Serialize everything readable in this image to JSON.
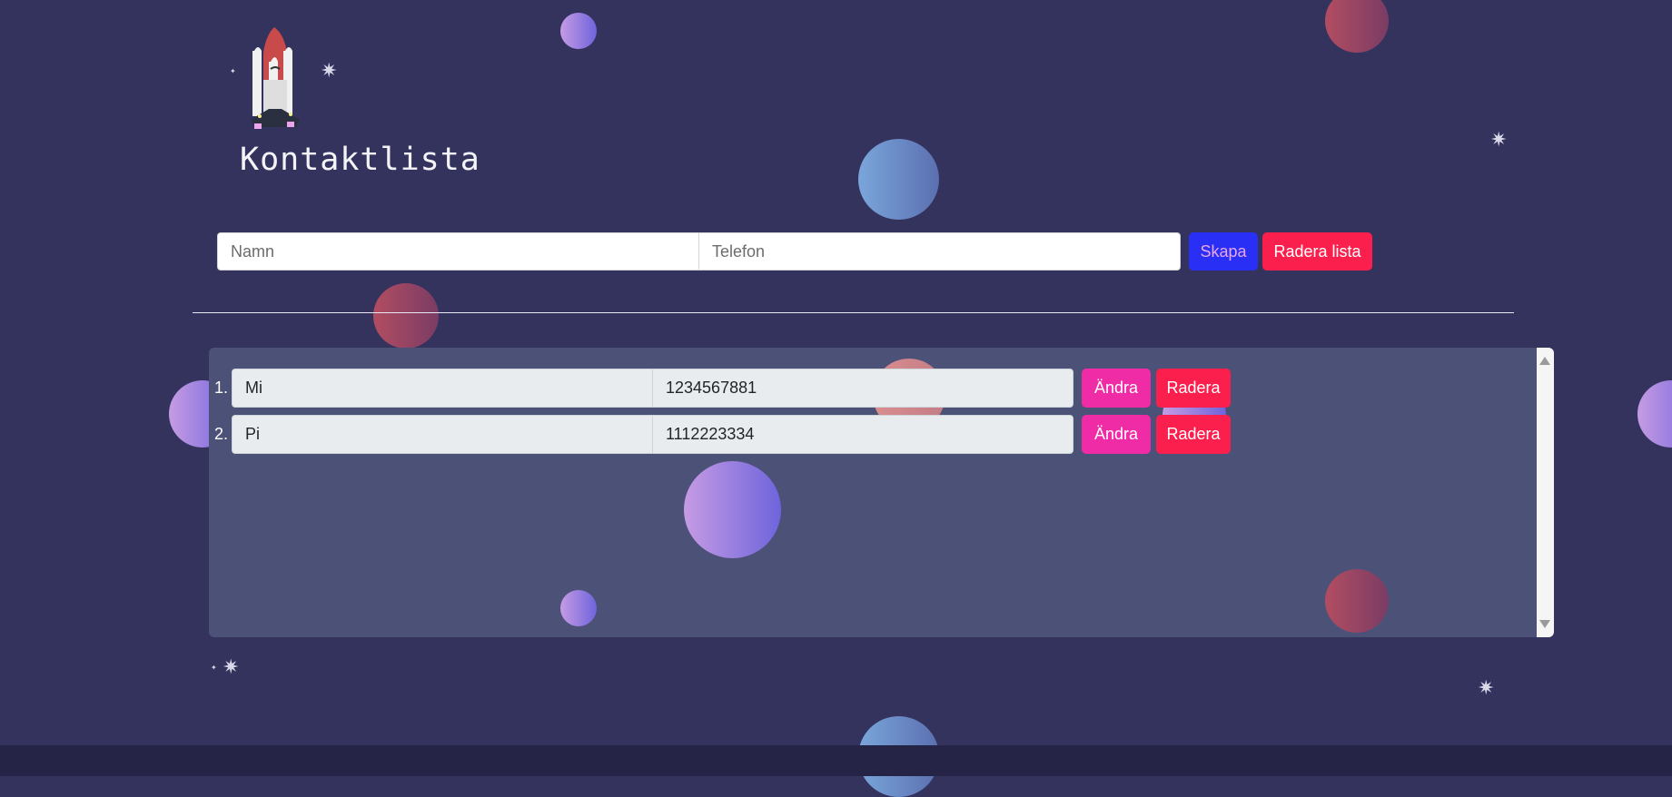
{
  "colors": {
    "background": "#34335e",
    "panel": "#4b5177",
    "create_button": "#2a2ff5",
    "delete_button": "#fb1f4d",
    "edit_button": "#ef2ba5"
  },
  "header": {
    "logo_icon": "rocket-shuttle-icon",
    "title": "Kontaktlista"
  },
  "form": {
    "name_placeholder": "Namn",
    "phone_placeholder": "Telefon",
    "create_label": "Skapa",
    "clear_list_label": "Radera lista"
  },
  "contacts": [
    {
      "index": "1.",
      "name": "Mi",
      "phone": "1234567881",
      "edit_label": "Ändra",
      "delete_label": "Radera"
    },
    {
      "index": "2.",
      "name": "Pi",
      "phone": "1112223334",
      "edit_label": "Ändra",
      "delete_label": "Radera"
    }
  ]
}
